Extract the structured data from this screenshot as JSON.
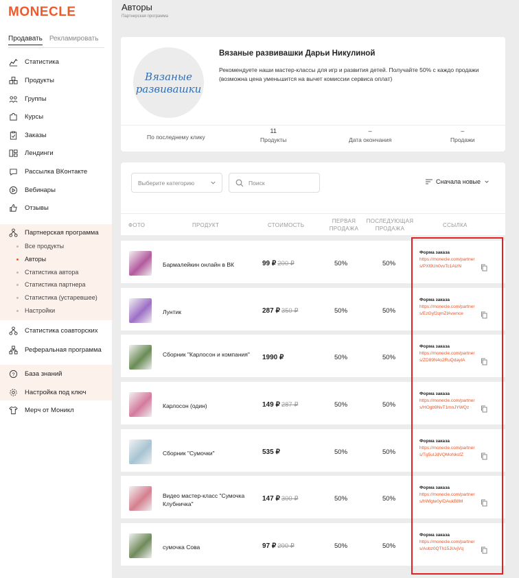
{
  "brand": {
    "logo": "MONECLE",
    "accent": "#ee5a2c"
  },
  "sidebar": {
    "tabs": [
      "Продавать",
      "Рекламировать"
    ],
    "items": [
      {
        "label": "Статистика",
        "icon": "chart-icon"
      },
      {
        "label": "Продукты",
        "icon": "boxes-icon"
      },
      {
        "label": "Группы",
        "icon": "group-icon"
      },
      {
        "label": "Курсы",
        "icon": "puzzle-icon"
      },
      {
        "label": "Заказы",
        "icon": "clipboard-icon"
      },
      {
        "label": "Лендинги",
        "icon": "landing-icon"
      },
      {
        "label": "Рассылка ВКонтакте",
        "icon": "chat-icon"
      },
      {
        "label": "Вебинары",
        "icon": "play-icon"
      },
      {
        "label": "Отзывы",
        "icon": "thumbs-up-icon"
      },
      {
        "label": "Партнерская программа",
        "icon": "network-icon"
      }
    ],
    "sub_items": [
      "Все продукты",
      "Авторы",
      "Статистика автора",
      "Статистика партнера",
      "Статистика (устаревшее)",
      "Настройки"
    ],
    "bottom_items": [
      {
        "label": "Статистика соавторских",
        "icon": "coauthor-icon"
      },
      {
        "label": "Реферальная программа",
        "icon": "referral-icon"
      },
      {
        "label": "База знаний",
        "icon": "help-icon"
      },
      {
        "label": "Настройка под ключ",
        "icon": "gear-icon"
      },
      {
        "label": "Мерч от Моникл",
        "icon": "tshirt-icon"
      }
    ]
  },
  "header": {
    "title": "Авторы",
    "subtitle": "Партнерская программа"
  },
  "author": {
    "avatar_text_1": "Вязаные",
    "avatar_text_2": "развивашки",
    "name": "Вязаные развивашки Дарьи Никулиной",
    "description": "Рекомендуете наши мастер-классы для игр и развития детей. Получайте 50% с каждо продажи (возможна цена уменьшится на вычет комиссии сервиса оплат)",
    "stats": {
      "attribution": "По последнему клику",
      "products_value": "11",
      "products_label": "Продукты",
      "end_value": "–",
      "end_label": "Дата окончания",
      "sales_value": "–",
      "sales_label": "Продажи"
    }
  },
  "filters": {
    "category_placeholder": "Выберите категорию",
    "search_placeholder": "Поиск",
    "sort_label": "Сначала новые"
  },
  "table": {
    "headers": {
      "photo": "ФОТО",
      "product": "ПРОДУКТ",
      "price": "СТОИМОСТЬ",
      "first": "ПЕРВАЯ ПРОДАЖА",
      "next": "ПОСЛЕДУЮЩАЯ ПРОДАЖА",
      "link": "ССЫЛКА"
    },
    "link_title": "Форма заказа",
    "rows": [
      {
        "name": "Бармалейкин онлайн в ВК",
        "price": "99 ₽",
        "old_price": "200 ₽",
        "first": "50%",
        "next": "50%",
        "url": "https://monecle.com/partners/PXl9Un0vvTc1AizN",
        "thumb": "#b35a9e"
      },
      {
        "name": "Лунтик",
        "price": "287 ₽",
        "old_price": "350 ₽",
        "first": "50%",
        "next": "50%",
        "url": "https://monecle.com/partners/EzGyf2qmZIAvwnce",
        "thumb": "#9d6fc5"
      },
      {
        "name": "Сборник \"Карлосон и компания\"",
        "price": "1990 ₽",
        "old_price": "",
        "first": "50%",
        "next": "50%",
        "url": "https://monecle.com/partners/ZD89N4o2RuQdayIA",
        "thumb": "#6a8b55"
      },
      {
        "name": "Карлосон (один)",
        "price": "149 ₽",
        "old_price": "287 ₽",
        "first": "50%",
        "next": "50%",
        "url": "https://monecle.com/partners/HOgb9NvT1mnJYWQz",
        "thumb": "#d47a9c"
      },
      {
        "name": "Сборник \"Сумочки\"",
        "price": "535 ₽",
        "old_price": "",
        "first": "50%",
        "next": "50%",
        "url": "https://monecle.com/partners/Tg5uIJdVQMoNksfZ",
        "thumb": "#a7c3d3"
      },
      {
        "name": "Видео мастер-класс \"Сумочка Клубничка\"",
        "price": "147 ₽",
        "old_price": "300 ₽",
        "first": "50%",
        "next": "50%",
        "url": "https://monecle.com/partners/hWlgte0yIDAukB8M",
        "thumb": "#d57f8f"
      },
      {
        "name": "сумочка Сова",
        "price": "97 ₽",
        "old_price": "200 ₽",
        "first": "50%",
        "next": "50%",
        "url": "https://monecle.com/partners/Aobz0QTh15JUvjVq",
        "thumb": "#6f8a5a"
      }
    ]
  }
}
